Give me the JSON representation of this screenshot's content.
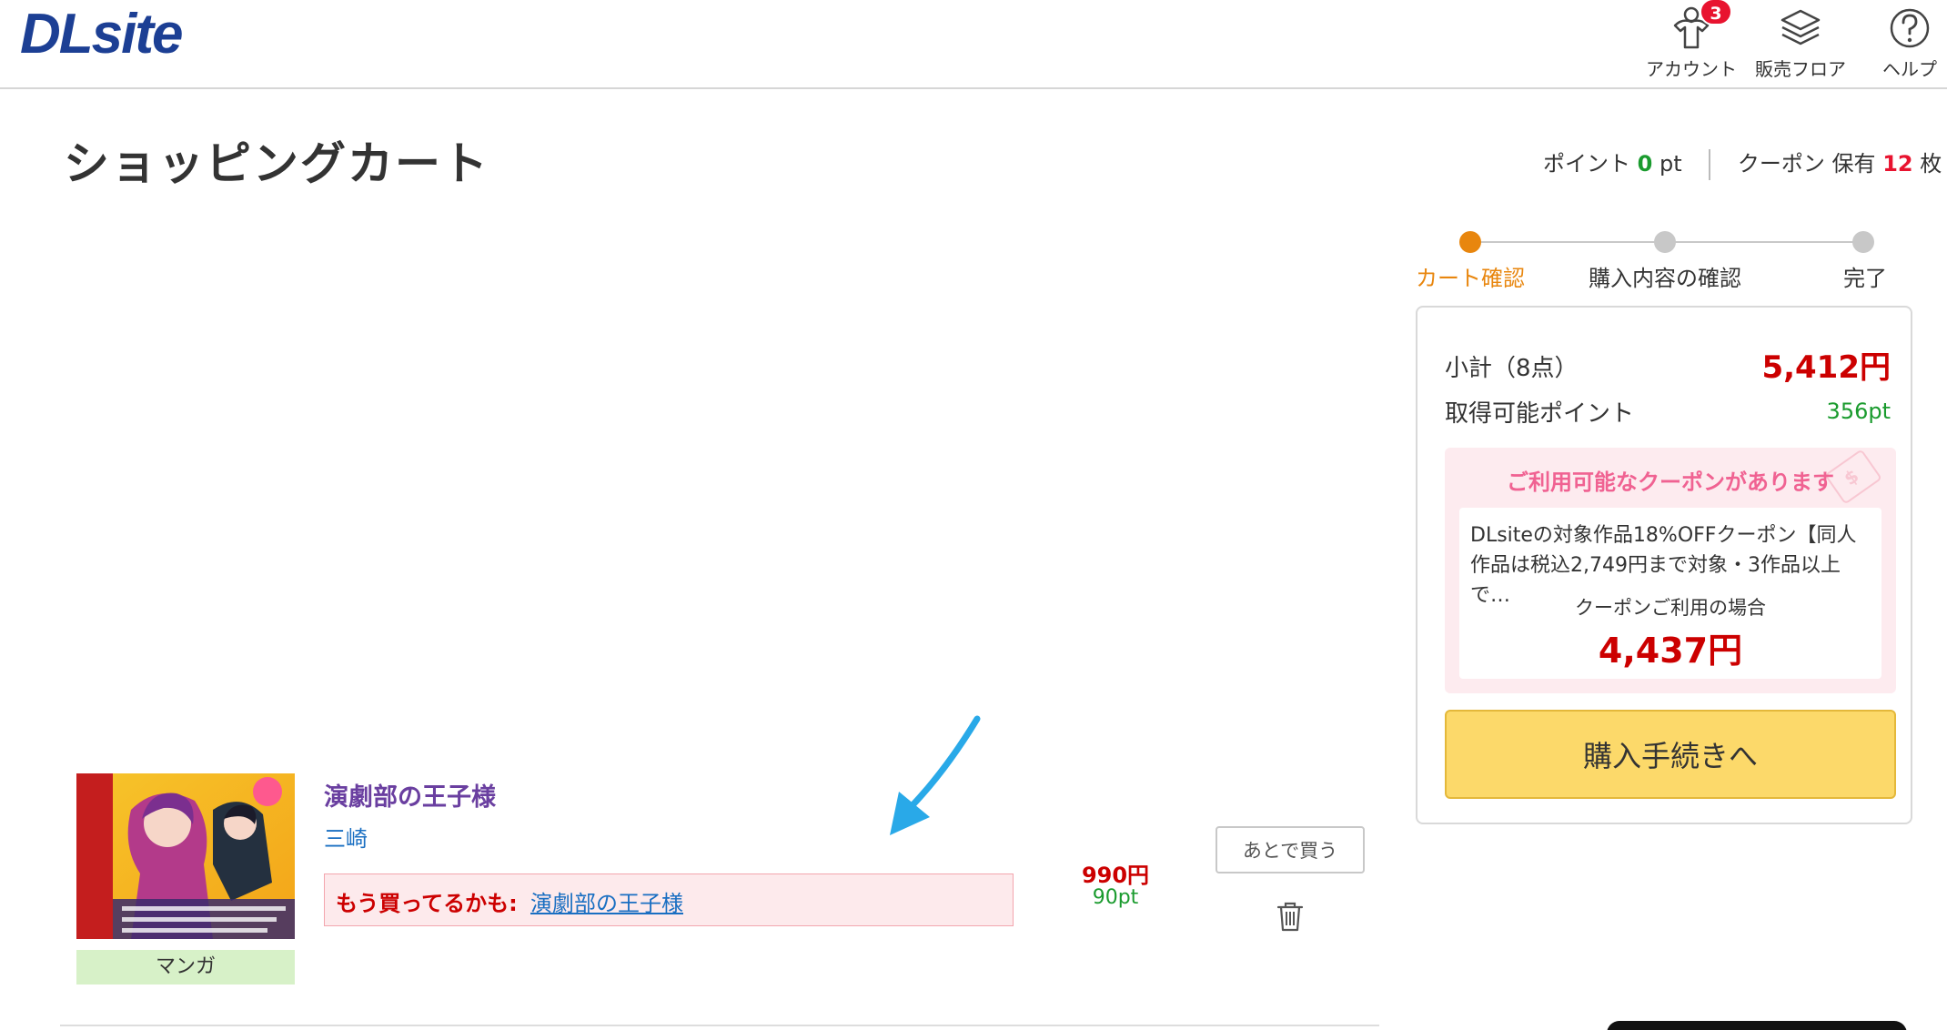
{
  "header": {
    "logo": "DLsite",
    "nav": [
      {
        "label": "アカウント",
        "icon": "account-icon",
        "badge": "3"
      },
      {
        "label": "販売フロア",
        "icon": "layers-icon"
      },
      {
        "label": "ヘルプ",
        "icon": "help-icon"
      }
    ]
  },
  "page": {
    "title": "ショッピングカート",
    "points_label": "ポイント",
    "points_value": "0",
    "points_unit": "pt",
    "coupon_label": "クーポン 保有",
    "coupon_count": "12",
    "coupon_unit": "枚"
  },
  "steps": [
    {
      "label": "カート確認",
      "active": true
    },
    {
      "label": "購入内容の確認",
      "active": false
    },
    {
      "label": "完了",
      "active": false
    }
  ],
  "summary": {
    "subtotal_label": "小計（8点）",
    "subtotal_value": "5,412円",
    "points_label": "取得可能ポイント",
    "points_value": "356pt",
    "coupon_heading": "ご利用可能なクーポンがあります",
    "coupon_tag_glyph": "$",
    "coupon_desc": "DLsiteの対象作品18%OFFクーポン【同人作品は税込2,749円まで対象・3作品以上で…",
    "coupon_note": "クーポンご利用の場合",
    "coupon_price": "4,437円",
    "buy_button": "購入手続きへ"
  },
  "cart_item": {
    "title": "演劇部の王子様",
    "author": "三崎",
    "category": "マンガ",
    "already_label": "もう買ってるかも:",
    "already_link": "演劇部の王子様",
    "price": "990円",
    "points": "90pt",
    "later_button": "あとで買う"
  },
  "colors": {
    "brand": "#1c3f94",
    "accent_orange": "#e8860e",
    "price_red": "#cc0000",
    "point_green": "#1a9b2e",
    "coupon_pink": "#f06292",
    "buy_yellow": "#fcd96a"
  }
}
